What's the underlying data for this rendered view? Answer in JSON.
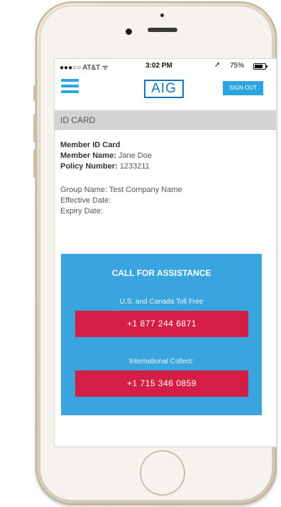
{
  "status_bar": {
    "carrier": "●●●○○ AT&T ᯤ",
    "time": "3:02 PM",
    "battery_percent": "75%",
    "battery_level": 0.75
  },
  "header": {
    "logo": "AIG",
    "signout_label": "SIGN OUT"
  },
  "section": {
    "title": "ID CARD"
  },
  "member": {
    "card_title": "Member ID Card",
    "name_label": "Member Name:",
    "name_value": "Jane Doe",
    "policy_label": "Policy Number:",
    "policy_value": "1233211",
    "group_label": "Group Name:",
    "group_value": "Test Company Name",
    "effective_label": "Effective Date:",
    "expiry_label": "Expiry Date:"
  },
  "assistance": {
    "title": "CALL FOR ASSISTANCE",
    "tollfree_label": "U.S. and Canada Toll Free",
    "tollfree_number": "+1 877 244 6871",
    "intl_label": "International Collect:",
    "intl_number": "+1 715 346 0859"
  },
  "colors": {
    "accent_blue": "#2ba4df",
    "logo_blue": "#1275bb",
    "call_red": "#d31f45",
    "assist_panel": "#3aa4de",
    "section_gray": "#d3d3d3"
  }
}
